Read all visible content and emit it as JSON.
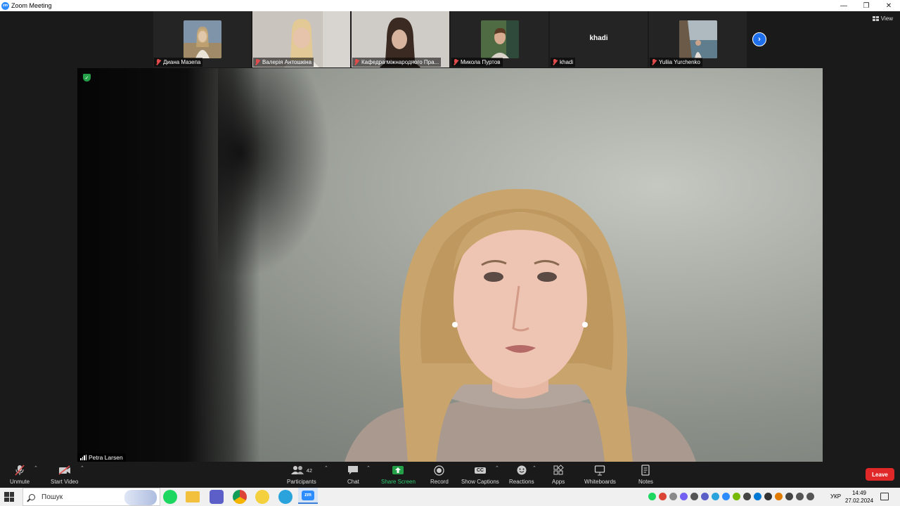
{
  "window": {
    "title": "Zoom Meeting",
    "app_icon_text": "zm"
  },
  "view_button": {
    "label": "View"
  },
  "participants_strip": [
    {
      "name": "Диана Мазепа",
      "muted": true,
      "thumb_color": "#a8927c"
    },
    {
      "name": "Валерія Антошкіна",
      "muted": true,
      "thumb_color": "#b9ada4"
    },
    {
      "name": "Кафедра міжнародного Пра...",
      "muted": true,
      "thumb_color": "#9c9790"
    },
    {
      "name": "Микола Пуртов",
      "muted": true,
      "thumb_color": "#5b6b4a"
    },
    {
      "name": "khadi",
      "muted": true,
      "center_label": "khadi"
    },
    {
      "name": "Yuliia Yurchenko",
      "muted": true,
      "thumb_color": "#8fa3ae"
    }
  ],
  "active_speaker": {
    "name": "Petra Larsen"
  },
  "toolbar": {
    "unmute": "Unmute",
    "start_video": "Start Video",
    "participants": "Participants",
    "participants_count": "42",
    "chat": "Chat",
    "share_screen": "Share Screen",
    "record": "Record",
    "show_captions": "Show Captions",
    "captions_icon_text": "CC",
    "reactions": "Reactions",
    "apps": "Apps",
    "whiteboards": "Whiteboards",
    "notes": "Notes",
    "leave": "Leave"
  },
  "taskbar": {
    "search_placeholder": "Пошук",
    "language": "УКР",
    "time": "14:49",
    "date": "27.02.2024",
    "apps": [
      {
        "name": "spotify-icon",
        "color": "#1ed760"
      },
      {
        "name": "file-explorer-icon",
        "color": "#f3c03d"
      },
      {
        "name": "teams-icon",
        "color": "#5b5fc7"
      },
      {
        "name": "chrome-icon",
        "color": "#db4437"
      },
      {
        "name": "chrome-profile-icon",
        "color": "#f4d03f"
      },
      {
        "name": "telegram-icon",
        "color": "#2aa3dd"
      },
      {
        "name": "zoom-icon",
        "color": "#2d8cff"
      }
    ]
  },
  "colors": {
    "accent": "#2d8cff",
    "leave": "#e02828",
    "share": "#24a148",
    "muted": "#e24b4b"
  }
}
